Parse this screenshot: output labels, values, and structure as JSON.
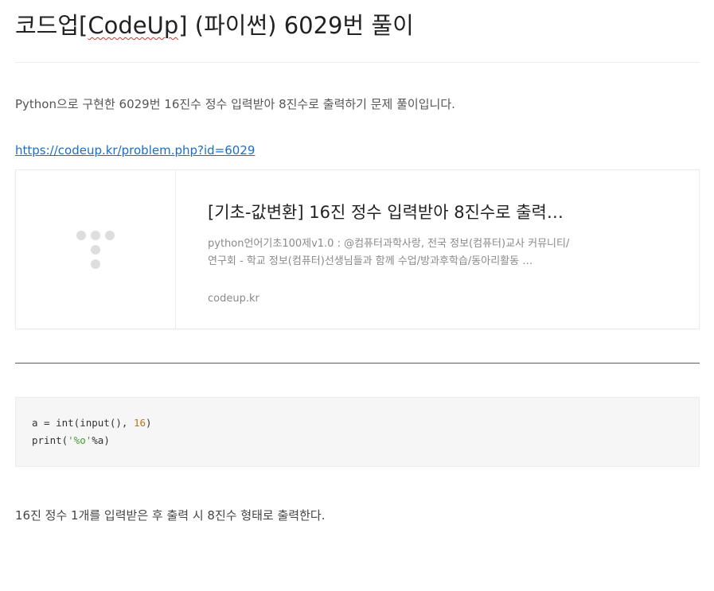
{
  "post": {
    "title_prefix": "코드업",
    "title_bracket_open": "[",
    "title_codeup": "CodeUp",
    "title_bracket_close": "]",
    "title_suffix": " (파이썬) 6029번 풀이",
    "intro": "Python으로 구현한 6029번 16진수 정수 입력받아 8진수로 출력하기 문제 풀이입니다.",
    "link_text": "https://codeup.kr/problem.php?id=6029",
    "outro": "16진 정수 1개를 입력받은 후 출력 시 8진수 형태로 출력한다."
  },
  "link_card": {
    "thumbnail_icon": "placeholder-dots-icon",
    "title": "[기초-값변환] 16진 정수 입력받아 8진수로 출력…",
    "description": "python언어기초100제v1.0 : @컴퓨터과학사랑, 전국 정보(컴퓨터)교사 커뮤니티/연구회 - 학교 정보(컴퓨터)선생님들과 함께 수업/방과후학습/동아리활동 …",
    "domain": "codeup.kr"
  },
  "code": {
    "line1_pre": "a = int(input(), ",
    "line1_num": "16",
    "line1_post": ")",
    "line2_pre": "print(",
    "line2_str": "'%o'",
    "line2_post": "%a)"
  },
  "colors": {
    "link": "#1a6fc4",
    "number_token": "#b5790f",
    "string_token": "#4a9a3a",
    "code_background": "#f6f6f6"
  }
}
